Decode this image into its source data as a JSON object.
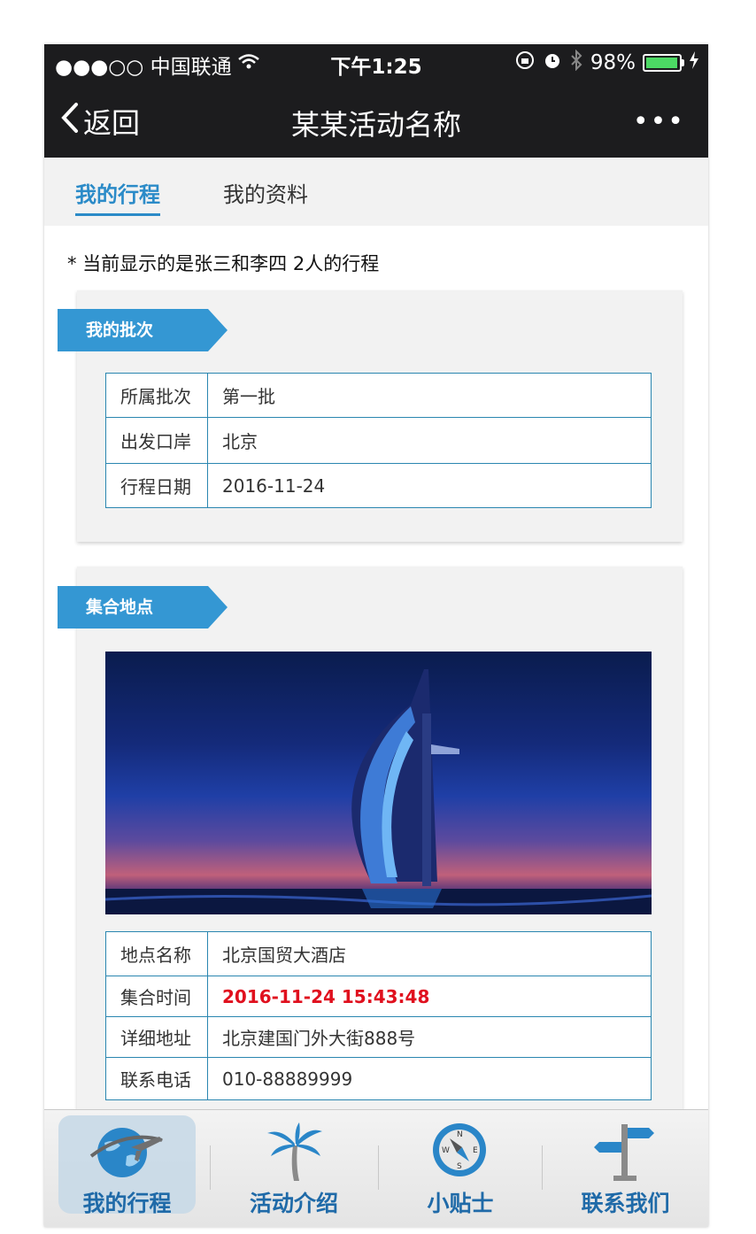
{
  "status_bar": {
    "carrier": "●●●○○ 中国联通",
    "time": "下午1:25",
    "battery": "98%",
    "battery_level": 0.98
  },
  "nav": {
    "back_label": "返回",
    "title": "某某活动名称",
    "more_label": "•••"
  },
  "tabs": [
    {
      "label": "我的行程",
      "active": true
    },
    {
      "label": "我的资料",
      "active": false
    }
  ],
  "notice": "* 当前显示的是张三和李四 2人的行程",
  "batch_card": {
    "ribbon": "我的批次",
    "rows": [
      {
        "key": "所属批次",
        "value": "第一批"
      },
      {
        "key": "出发口岸",
        "value": "北京"
      },
      {
        "key": "行程日期",
        "value": "2016-11-24"
      }
    ]
  },
  "meeting_card": {
    "ribbon": "集合地点",
    "rows": [
      {
        "key": "地点名称",
        "value": "北京国贸大酒店"
      },
      {
        "key": "集合时间",
        "value": "2016-11-24 15:43:48"
      },
      {
        "key": "详细地址",
        "value": "北京建国门外大街888号"
      },
      {
        "key": "联系电话",
        "value": "010-88889999"
      }
    ]
  },
  "tabbar": [
    {
      "label": "我的行程",
      "icon": "globe-plane-icon",
      "active": true
    },
    {
      "label": "活动介绍",
      "icon": "palm-tree-icon",
      "active": false
    },
    {
      "label": "小贴士",
      "icon": "compass-icon",
      "active": false
    },
    {
      "label": "联系我们",
      "icon": "signpost-icon",
      "active": false
    }
  ],
  "colors": {
    "accent": "#3497d3",
    "table_border": "#2a86b0",
    "time_highlight": "#e0101e",
    "tab_label": "#1f6aa8"
  }
}
